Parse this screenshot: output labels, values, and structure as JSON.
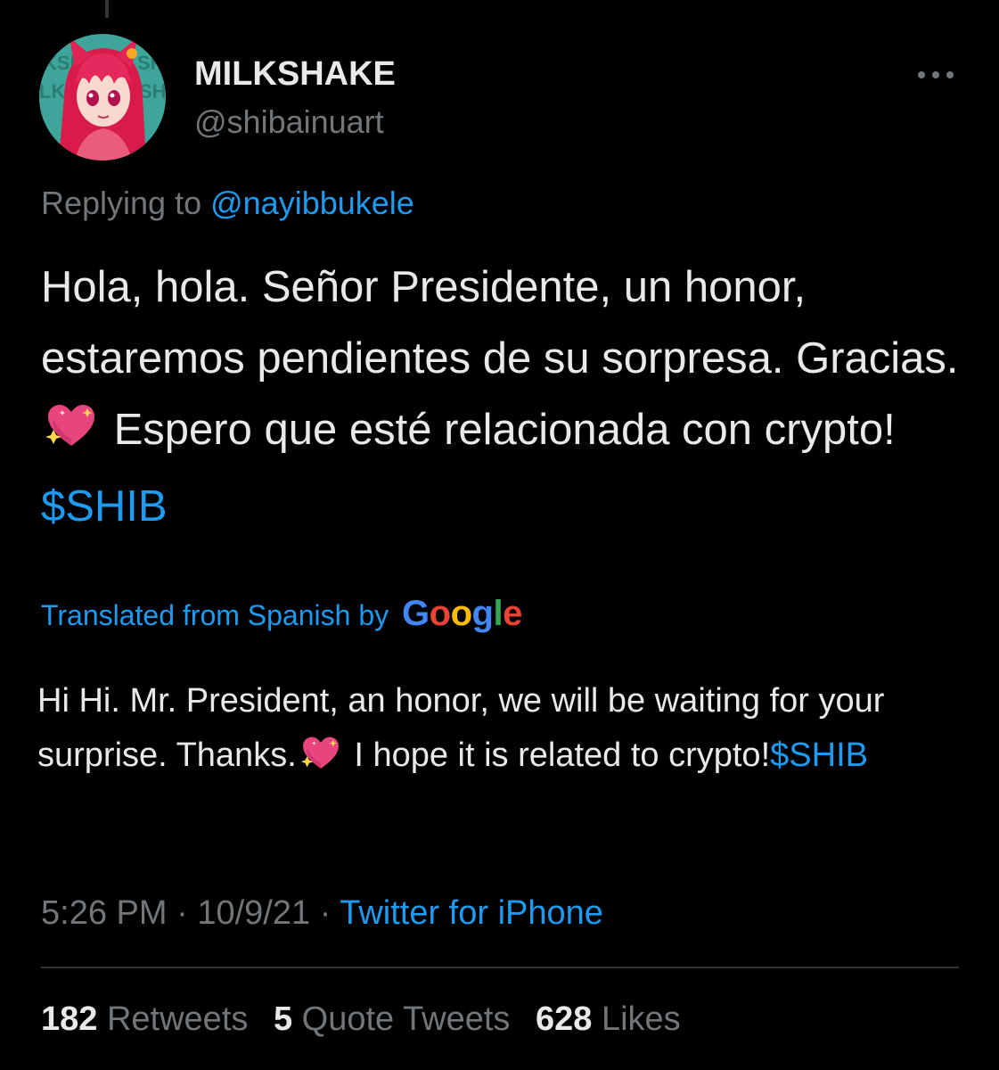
{
  "user": {
    "display_name": "MILKSHAKE",
    "handle": "@shibainuart",
    "avatar_icon": "anime-girl-avatar"
  },
  "reply": {
    "prefix": "Replying to ",
    "mention": "@nayibbukele"
  },
  "tweet": {
    "text_part1": "Hola, hola. Señor Presidente, un honor, estaremos pendientes de su sorpresa. Gracias.",
    "emoji": "sparkling-heart-emoji",
    "text_part2": "Espero que esté relacionada con crypto!",
    "cashtag": "$SHIB"
  },
  "translation": {
    "label": "Translated from Spanish by",
    "provider": "Google",
    "provider_colors": [
      "#4285F4",
      "#EA4335",
      "#FBBC05",
      "#4285F4",
      "#34A853",
      "#EA4335"
    ],
    "text_part1": "Hi Hi. Mr. President, an honor, we will be waiting for your surprise. Thanks.",
    "emoji": "sparkling-heart-emoji",
    "text_part2": "I hope it is related to crypto!",
    "cashtag": "$SHIB"
  },
  "meta": {
    "time": "5:26 PM",
    "separator": "·",
    "date": "10/9/21",
    "source": "Twitter for iPhone"
  },
  "stats": {
    "retweets_count": "182",
    "retweets_label": "Retweets",
    "quotes_count": "5",
    "quotes_label": "Quote Tweets",
    "likes_count": "628",
    "likes_label": "Likes"
  },
  "colors": {
    "background": "#000000",
    "text": "#e7e9ea",
    "secondary": "#71767b",
    "link": "#1d9bf0",
    "divider": "#2f3336"
  }
}
